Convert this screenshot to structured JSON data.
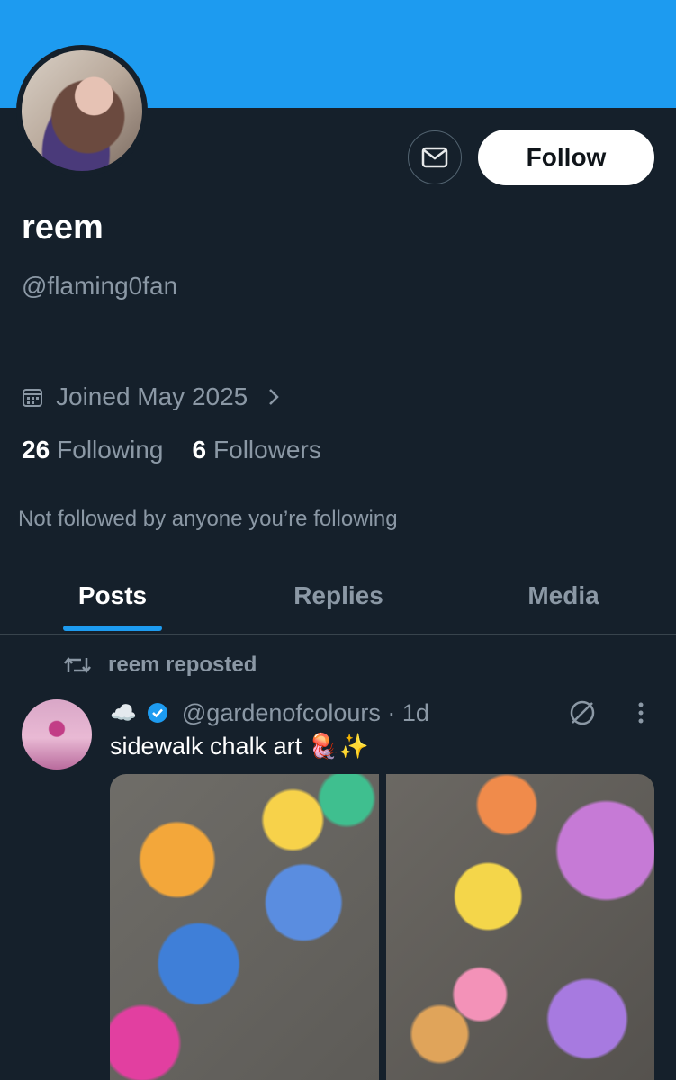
{
  "profile": {
    "name": "reem",
    "handle": "@flaming0fan",
    "joined": "Joined May 2025",
    "following_count": "26",
    "following_label": "Following",
    "followers_count": "6",
    "followers_label": "Followers",
    "mutuals_note": "Not followed by anyone you’re following"
  },
  "actions": {
    "follow_label": "Follow",
    "message_icon": "envelope-icon"
  },
  "tabs": [
    {
      "label": "Posts",
      "active": true
    },
    {
      "label": "Replies",
      "active": false
    },
    {
      "label": "Media",
      "active": false
    }
  ],
  "feed": {
    "repost_note": "reem reposted",
    "post": {
      "display_name_emoji": "☁️",
      "handle_time": "@gardenofcolours · 1d",
      "text": "sidewalk chalk art 🪼✨",
      "images": [
        "chalk-jellyfish-stars",
        "chalk-jellyfish-flowers"
      ]
    }
  },
  "colors": {
    "accent": "#1d9bf0",
    "background": "#15202b",
    "secondary_text": "#8b98a5",
    "primary_text": "#ffffff"
  }
}
